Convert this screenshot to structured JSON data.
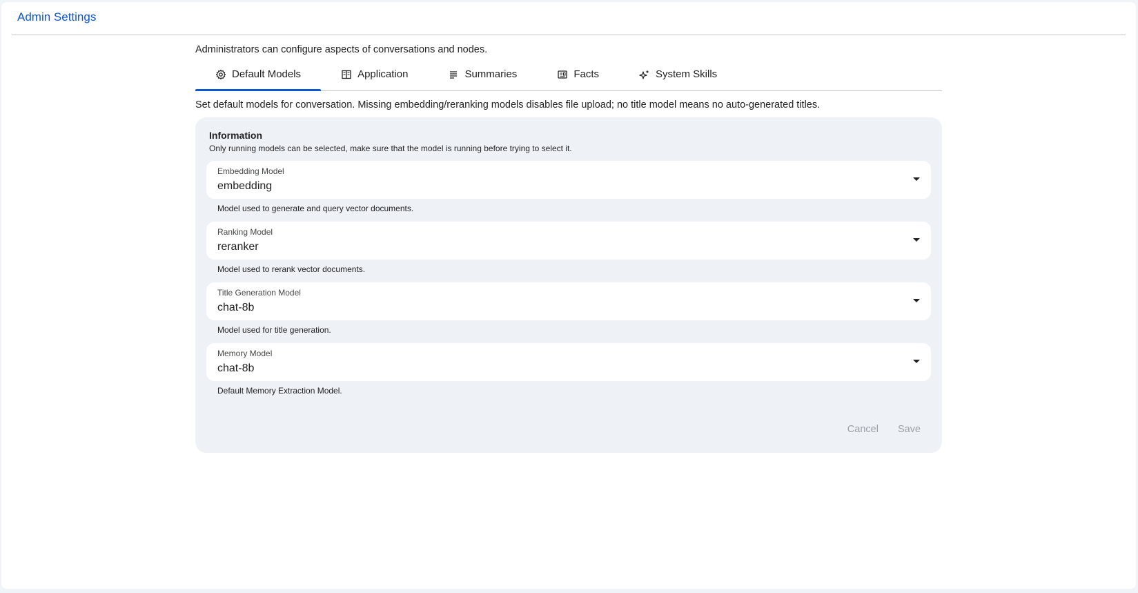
{
  "header": {
    "title": "Admin Settings"
  },
  "intro": "Administrators can configure aspects of conversations and nodes.",
  "tabs": [
    {
      "label": "Default Models",
      "icon": "gear-icon",
      "active": true
    },
    {
      "label": "Application",
      "icon": "columns-icon",
      "active": false
    },
    {
      "label": "Summaries",
      "icon": "list-lines-icon",
      "active": false
    },
    {
      "label": "Facts",
      "icon": "fact-card-icon",
      "active": false
    },
    {
      "label": "System Skills",
      "icon": "sparkles-icon",
      "active": false
    }
  ],
  "description": "Set default models for conversation. Missing embedding/reranking models disables file upload; no title model means no auto-generated titles.",
  "panel": {
    "info_title": "Information",
    "info_text": "Only running models can be selected, make sure that the model is running before trying to select it.",
    "fields": [
      {
        "label": "Embedding Model",
        "value": "embedding",
        "helper": "Model used to generate and query vector documents."
      },
      {
        "label": "Ranking Model",
        "value": "reranker",
        "helper": "Model used to rerank vector documents."
      },
      {
        "label": "Title Generation Model",
        "value": "chat-8b",
        "helper": "Model used for title generation."
      },
      {
        "label": "Memory Model",
        "value": "chat-8b",
        "helper": "Default Memory Extraction Model."
      }
    ],
    "cancel_label": "Cancel",
    "save_label": "Save"
  },
  "colors": {
    "accent": "#0b57d0",
    "panel_bg": "#eef2f7",
    "disabled_text": "#9aa0a6"
  }
}
